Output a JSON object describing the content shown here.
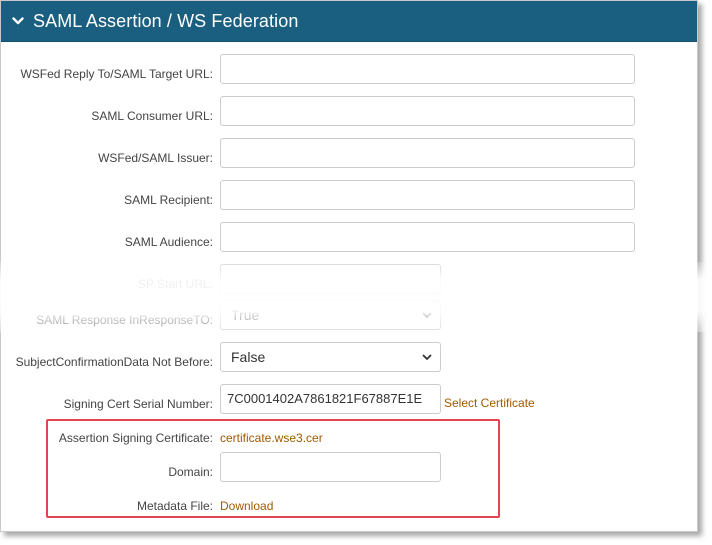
{
  "header": {
    "title": "SAML Assertion / WS Federation"
  },
  "fields": {
    "wsfed_reply_to": {
      "label": "WSFed Reply To/SAML Target URL:",
      "value": ""
    },
    "saml_consumer_url": {
      "label": "SAML Consumer URL:",
      "value": ""
    },
    "wsfed_saml_issuer": {
      "label": "WSFed/SAML Issuer:",
      "value": ""
    },
    "saml_recipient": {
      "label": "SAML Recipient:",
      "value": ""
    },
    "saml_audience": {
      "label": "SAML Audience:",
      "value": ""
    },
    "sp_start_url": {
      "label": "SP Start URL:",
      "value": ""
    },
    "saml_response_inresponseto": {
      "label": "SAML Response InResponseTO:",
      "value": "True"
    },
    "subject_confirmation": {
      "label": "SubjectConfirmationData Not Before:",
      "value": "False"
    },
    "signing_cert_serial": {
      "label": "Signing Cert Serial Number:",
      "value": "7C0001402A7861821F67887E1E",
      "link": "Select Certificate"
    },
    "assertion_signing_cert": {
      "label": "Assertion Signing Certificate:",
      "value": "certificate.wse3.cer"
    },
    "domain": {
      "label": "Domain:",
      "value": ""
    },
    "metadata_file": {
      "label": "Metadata File:",
      "link": "Download"
    }
  },
  "colors": {
    "header_bg": "#1b5f80",
    "link": "#a05a00",
    "highlight_border": "#e0464f"
  },
  "icons": {
    "collapse": "chevron-down-icon",
    "select_caret": "chevron-down-icon"
  }
}
